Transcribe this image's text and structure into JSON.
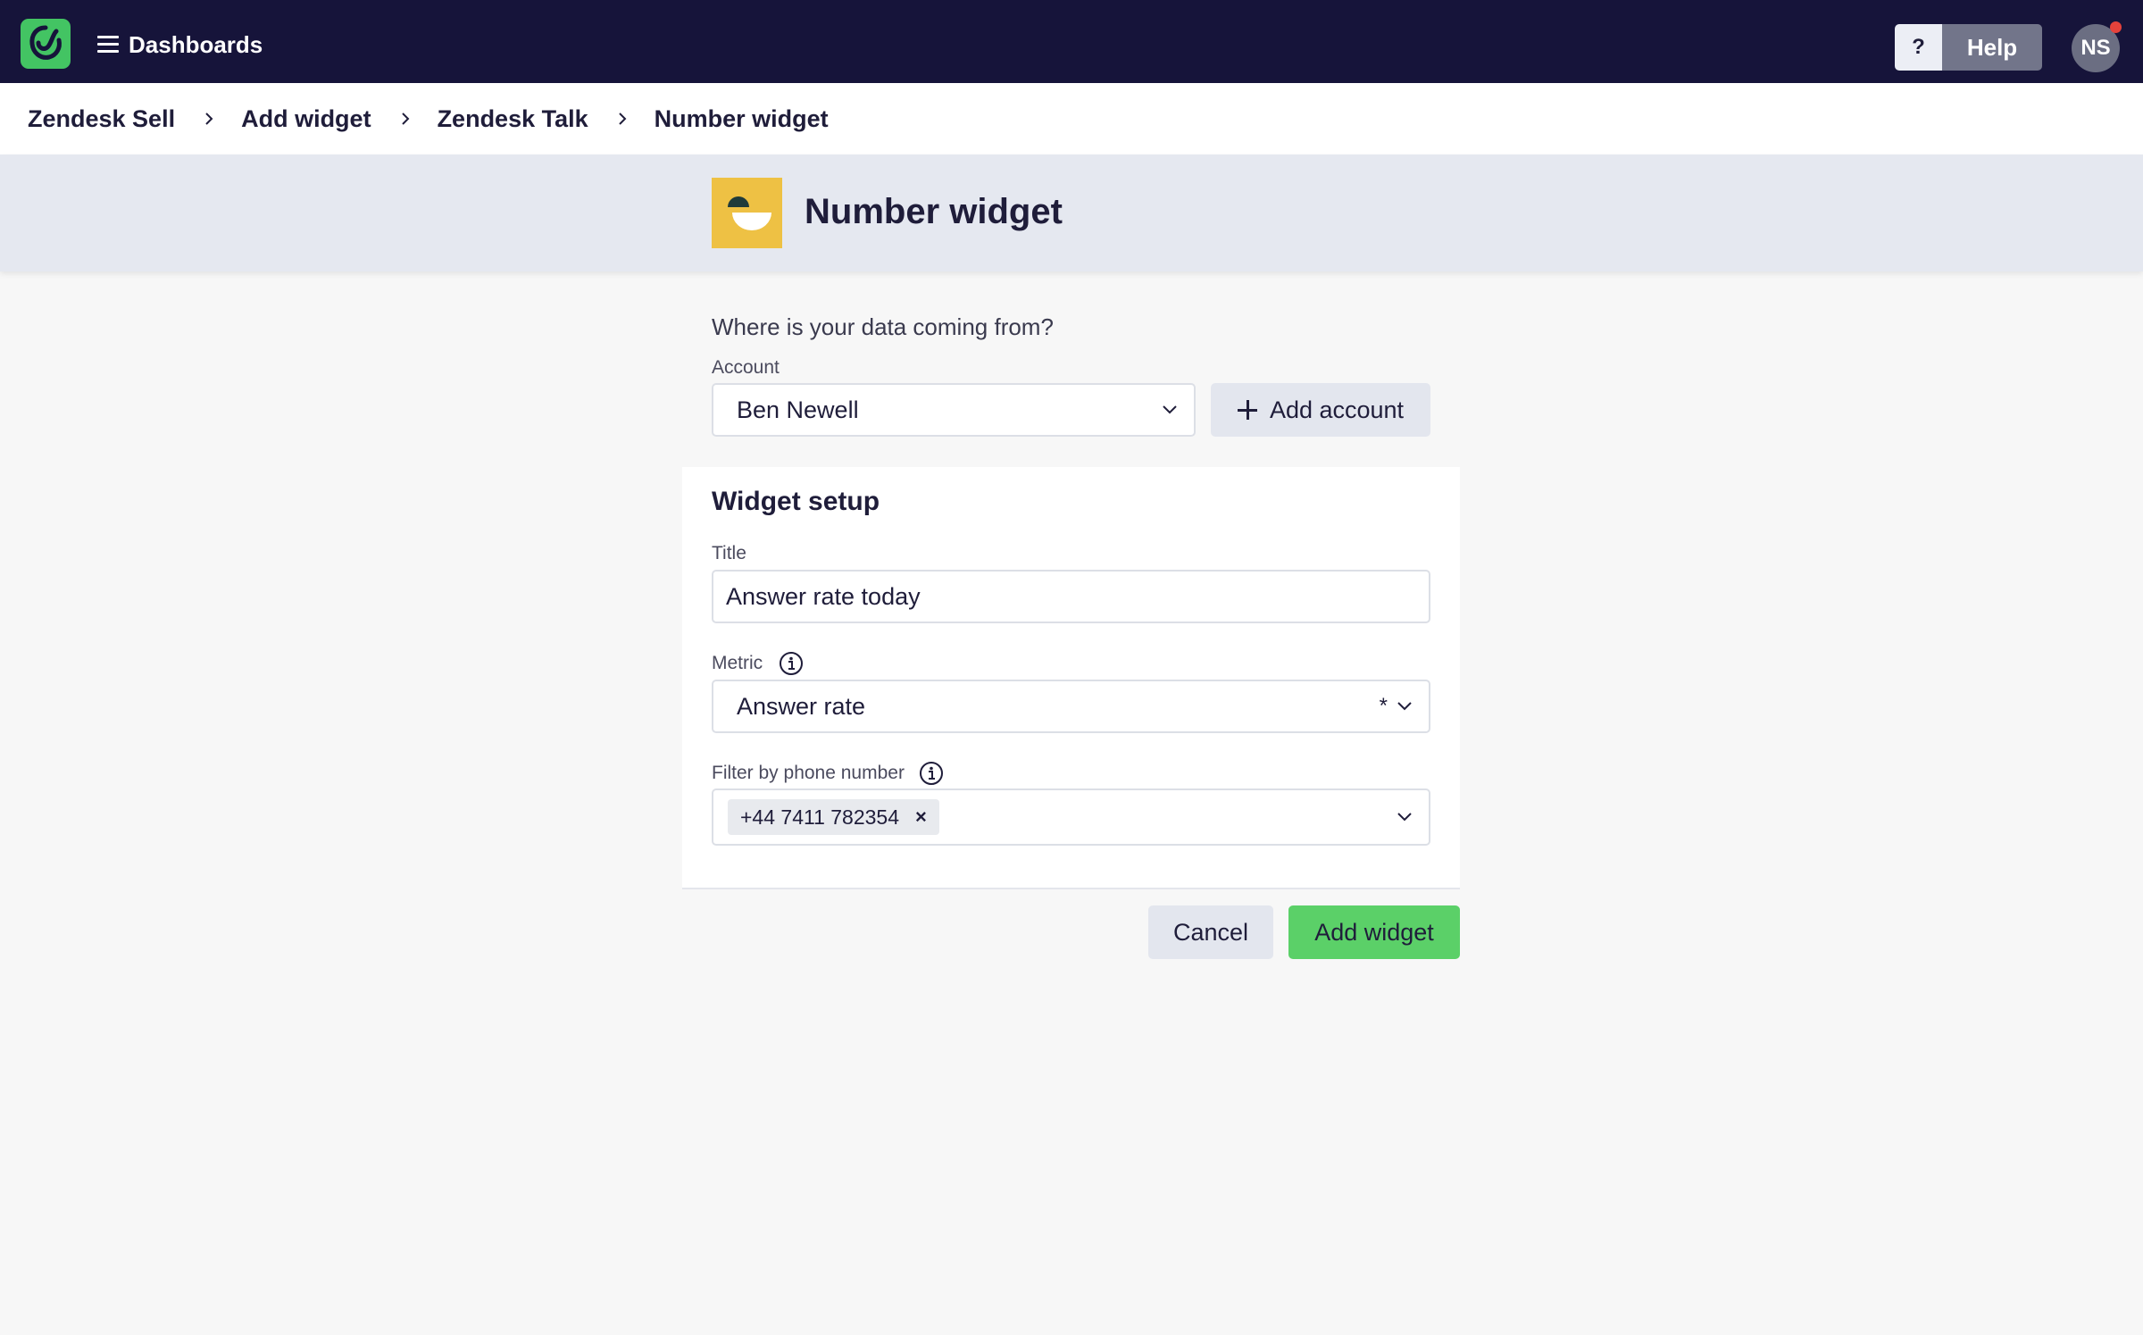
{
  "topbar": {
    "menu_label": "Dashboards",
    "help_question": "?",
    "help_label": "Help",
    "avatar_initials": "NS",
    "bar_color": "#16143a",
    "logo_color": "#43c463",
    "menu_icon": "hamburger-menu-icon"
  },
  "breadcrumb": {
    "items": [
      "Zendesk Sell",
      "Add widget",
      "Zendesk Talk"
    ],
    "current": "Number widget",
    "separator_icon": "chevron-right-icon"
  },
  "header": {
    "title": "Number widget",
    "icon": "number-widget-icon",
    "icon_color": "#eec144"
  },
  "source": {
    "question": "Where is your data coming from?",
    "account_label": "Account",
    "account_value": "Ben Newell",
    "add_account_label": "Add account"
  },
  "setup": {
    "title": "Widget setup",
    "title_label": "Title",
    "title_value": "Answer rate today",
    "metric_label": "Metric",
    "metric_value": "Answer rate",
    "metric_required": "*",
    "filter_label": "Filter by phone number",
    "filter_chip": "+44 7411 782354",
    "chip_remove": "×"
  },
  "actions": {
    "cancel_label": "Cancel",
    "add_label": "Add widget",
    "add_color": "#5bd068"
  }
}
